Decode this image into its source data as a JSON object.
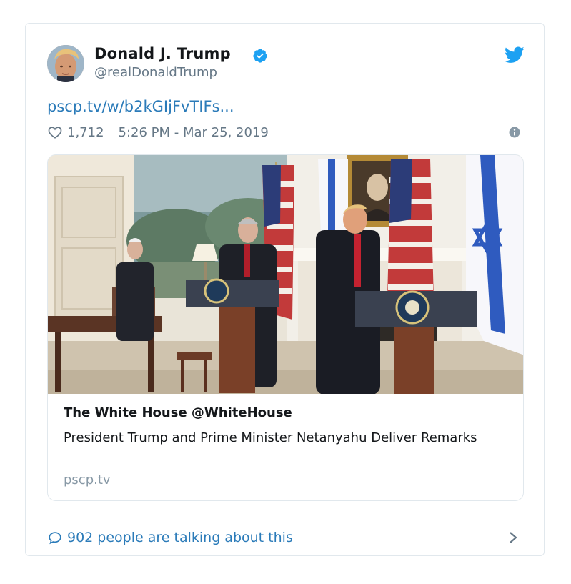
{
  "tweet": {
    "author_name": "Donald J. Trump",
    "author_handle": "@realDonaldTrump",
    "link_text": "pscp.tv/w/b2kGIjFvTIFs...",
    "likes": "1,712",
    "timestamp": "5:26 PM - Mar 25, 2019"
  },
  "card": {
    "title": "The White House @WhiteHouse",
    "description": "President Trump and Prime Minister Netanyahu Deliver Remarks",
    "domain": "pscp.tv"
  },
  "footer": {
    "talking": "902 people are talking about this"
  },
  "icons": {
    "verified": "verified-badge-icon",
    "twitter": "twitter-bird-icon",
    "like": "heart-icon",
    "info": "info-icon",
    "reply": "speech-bubble-icon",
    "chevron": "chevron-right-icon"
  },
  "colors": {
    "link": "#2b7bb9",
    "verified": "#1da1f2",
    "muted": "#657786",
    "border": "#e1e8ed"
  }
}
